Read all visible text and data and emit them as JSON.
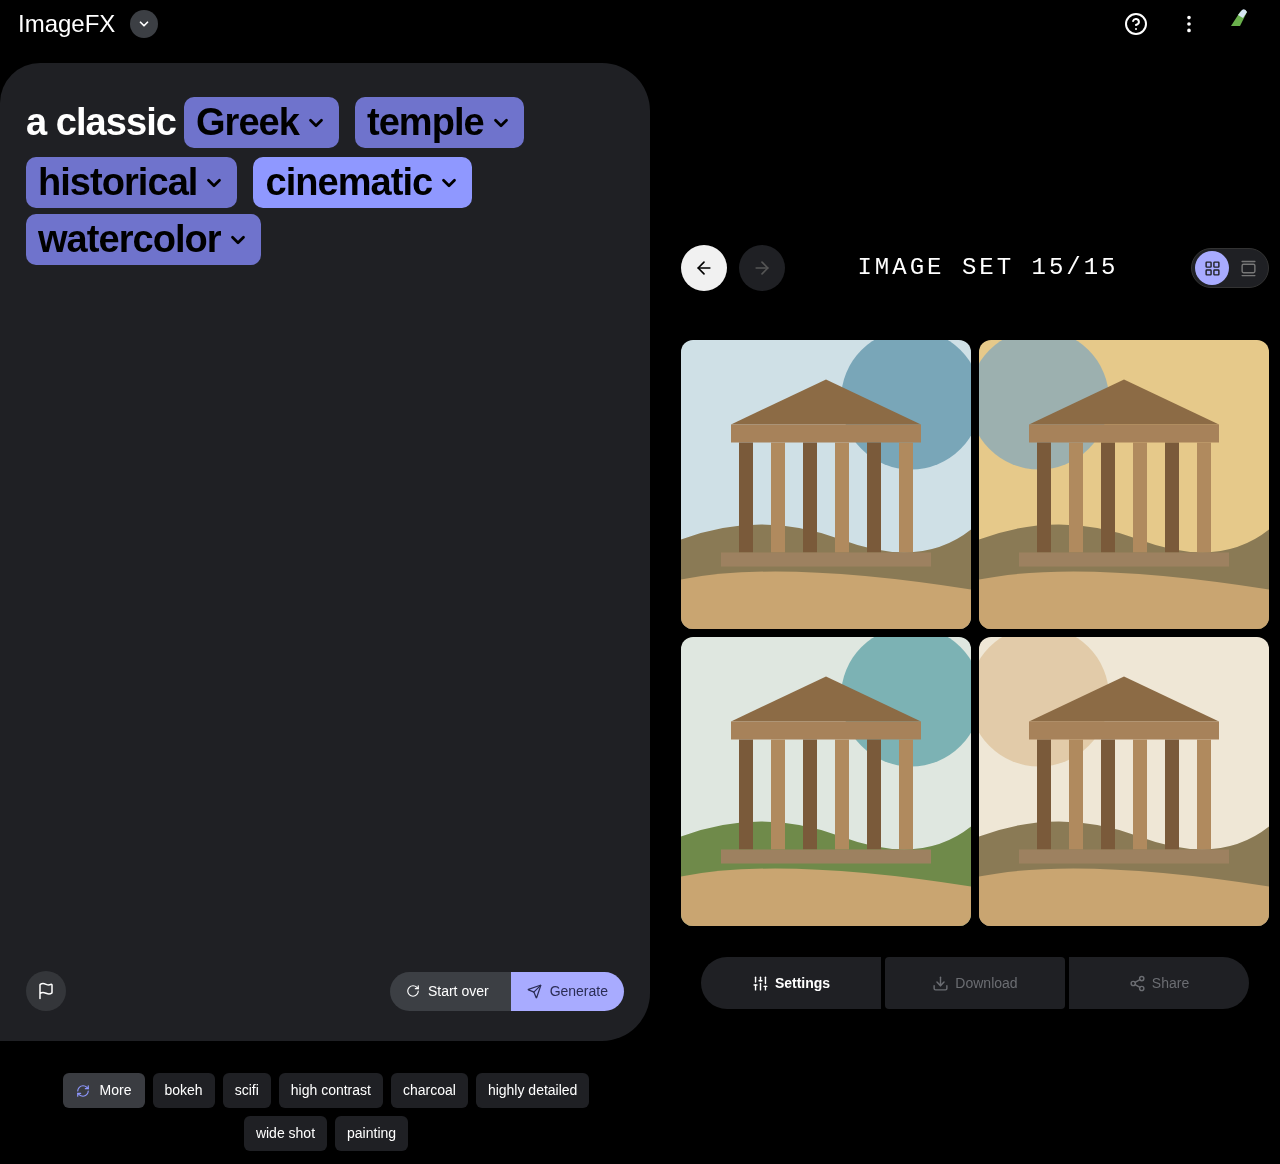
{
  "app": {
    "title": "ImageFX"
  },
  "prompt": {
    "lead": "a classic",
    "chips": [
      {
        "label": "Greek",
        "selected": false
      },
      {
        "label": "temple",
        "selected": false
      },
      {
        "label": "historical",
        "selected": false
      },
      {
        "label": "cinematic",
        "selected": true
      },
      {
        "label": "watercolor",
        "selected": false
      }
    ]
  },
  "actions": {
    "start_over": "Start over",
    "generate": "Generate"
  },
  "suggestions": {
    "more": "More",
    "items": [
      "bokeh",
      "scifi",
      "high contrast",
      "charcoal",
      "highly detailed",
      "wide shot",
      "painting"
    ]
  },
  "viewer": {
    "title": "IMAGE SET 15/15",
    "prev_disabled": false,
    "next_disabled": true,
    "views": [
      {
        "kind": "grid",
        "selected": true
      },
      {
        "kind": "single",
        "selected": false
      }
    ]
  },
  "bottom_buttons": [
    {
      "kind": "settings",
      "label": "Settings",
      "disabled": false
    },
    {
      "kind": "download",
      "label": "Download",
      "disabled": true
    },
    {
      "kind": "share",
      "label": "Share",
      "disabled": true
    }
  ]
}
